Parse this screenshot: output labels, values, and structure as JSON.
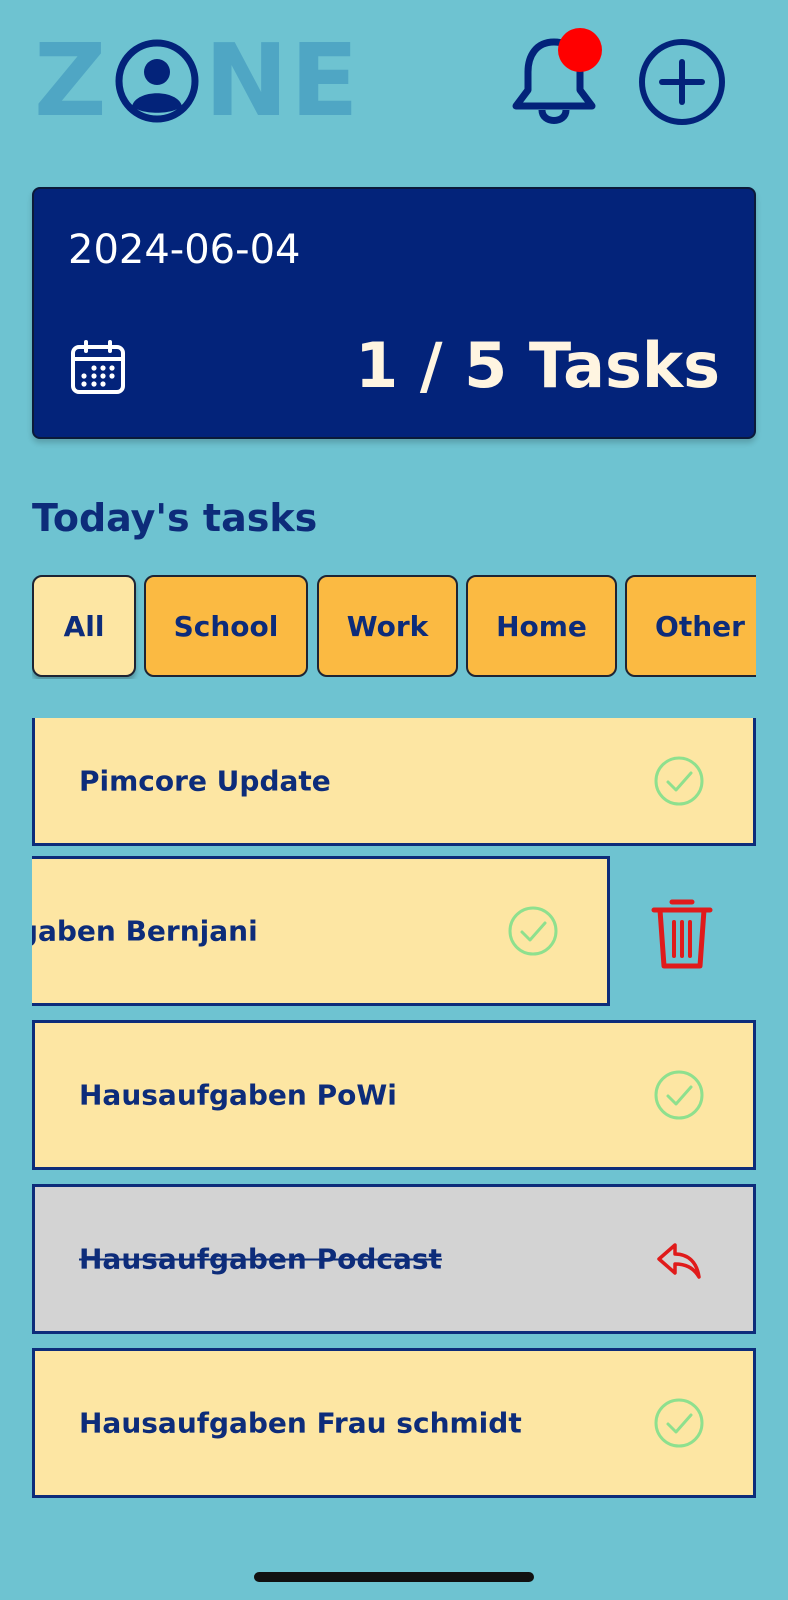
{
  "header": {
    "logo": {
      "before": "Z",
      "after": "NE",
      "color": "#4FA6C4",
      "icon": "user-circle-icon"
    },
    "notifications": {
      "icon": "bell-icon",
      "has_unread": true,
      "dot_color": "#FF0000"
    },
    "add": {
      "icon": "plus-circle-icon"
    }
  },
  "summary": {
    "date": "2024-06-04",
    "calendar_icon": "calendar-icon",
    "count_text": "1 / 5 Tasks",
    "background": "#03237A"
  },
  "section_title": "Today's tasks",
  "filters": [
    {
      "label": "All",
      "active": true
    },
    {
      "label": "School",
      "active": false
    },
    {
      "label": "Work",
      "active": false
    },
    {
      "label": "Home",
      "active": false
    },
    {
      "label": "Other",
      "active": false
    }
  ],
  "tasks": [
    {
      "label": "Pimcore Update",
      "done": false,
      "action_icon": "check-circle-icon"
    },
    {
      "label": "Hausaufgaben Bernjani",
      "done": false,
      "swiped": true,
      "action_icon": "check-circle-icon",
      "swipe_action_icon": "trash-icon"
    },
    {
      "label": "Hausaufgaben PoWi",
      "done": false,
      "action_icon": "check-circle-icon"
    },
    {
      "label": "Hausaufgaben Podcast",
      "done": true,
      "action_icon": "undo-arrow-icon"
    },
    {
      "label": "Hausaufgaben Frau schmidt",
      "done": false,
      "action_icon": "check-circle-icon"
    }
  ],
  "colors": {
    "background": "#6EC3D1",
    "task_card": "#FDE6A3",
    "task_done": "#D3D3D3",
    "chip": "#FBBA42",
    "chip_active": "#FDE6A3",
    "text_primary": "#0D2C7A",
    "check": "#8EE08E",
    "danger": "#E01B1B"
  }
}
